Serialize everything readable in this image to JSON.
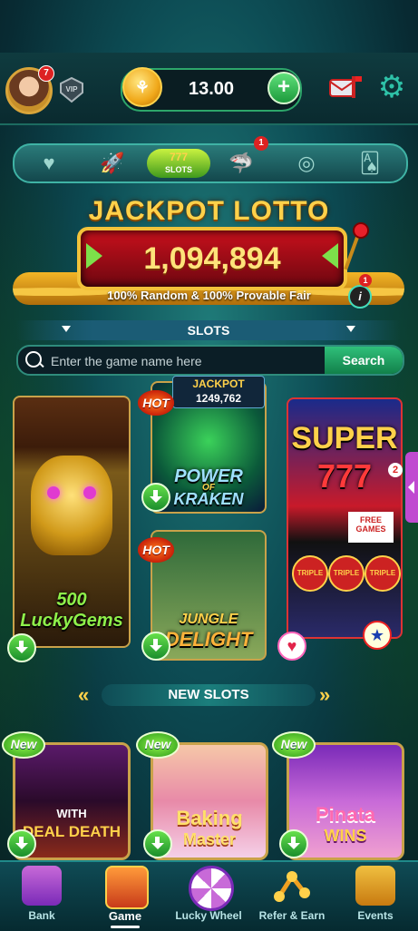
{
  "header": {
    "avatar_badge": "7",
    "vip_label": "VIP",
    "balance": "13.00",
    "plus_label": "+"
  },
  "categories": {
    "active_label_top": "777",
    "active_label": "SLOTS",
    "fish_badge": "1",
    "icons": [
      "heart-icon",
      "rocket-icon",
      "slots-icon",
      "shark-icon",
      "roulette-icon",
      "cards-icon"
    ]
  },
  "jackpot": {
    "title": "JACKPOT LOTTO",
    "value": "1,094,894",
    "subtitle": "100% Random & 100% Provable Fair",
    "info_badge": "1",
    "info_label": "i"
  },
  "slots_section": {
    "label": "SLOTS"
  },
  "search": {
    "placeholder": "Enter the game name here",
    "value": "",
    "button": "Search"
  },
  "games": {
    "lucky": {
      "name": "500 LuckyGems"
    },
    "kraken": {
      "hot": "HOT",
      "jackpot_label": "JACKPOT",
      "jackpot_value": "1249,762",
      "name_top": "POWER",
      "name_of": "OF",
      "name_bottom": "KRAKEN"
    },
    "jungle": {
      "hot": "HOT",
      "name_top": "JUNGLE",
      "name_bottom": "DELIGHT"
    },
    "super": {
      "title": "SUPER",
      "digits": "777",
      "badge": "2",
      "reel": "TRIPLE",
      "panel": "FREE GAMES"
    }
  },
  "new_section": {
    "label": "NEW SLOTS"
  },
  "new_games": [
    {
      "badge": "New",
      "name_top": "WITH",
      "name_bottom": "DEAL DEATH"
    },
    {
      "badge": "New",
      "name_top": "Baking",
      "name_bottom": "Master"
    },
    {
      "badge": "New",
      "name_top": "Pinata",
      "name_bottom": "WINS"
    }
  ],
  "nav": [
    {
      "label": "Bank"
    },
    {
      "label": "Game"
    },
    {
      "label": "Lucky Wheel"
    },
    {
      "label": "Refer & Earn"
    },
    {
      "label": "Events"
    }
  ],
  "colors": {
    "accent": "#2fc07a",
    "gold": "#ffd14a",
    "jackpot_red": "#c8101c"
  }
}
